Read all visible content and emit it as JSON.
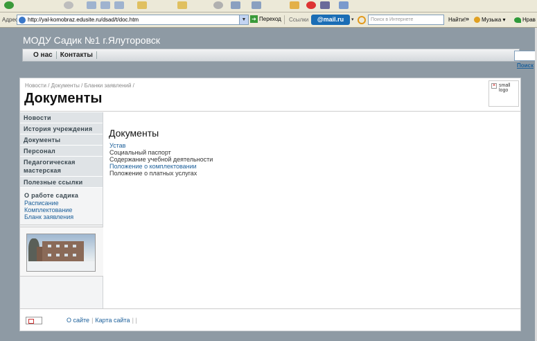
{
  "browser": {
    "address_label": "Адрес:",
    "url": "http://yal-komobraz.edusite.ru/dsad/t/doc.htm",
    "go_label": "Переход",
    "links_label": "Ссылки",
    "mailru_label": "@mail.ru",
    "search_placeholder": "Поиск в Интернете",
    "find_label": "Найти!",
    "more_label": "»",
    "music_label": "Музыка ▾",
    "pref_label": "Нрав"
  },
  "site": {
    "title": "МОДУ Садик №1 г.Ялуторовск",
    "topnav": [
      "О нас",
      "Контакты"
    ],
    "search_link": "Поиск"
  },
  "header": {
    "breadcrumb": [
      "Новости",
      "Документы",
      "Бланки заявлений"
    ],
    "page_title": "Документы",
    "logo_alt": "small logo"
  },
  "sidebar": {
    "items": [
      "Новости",
      "История учреждения",
      "Документы",
      "Персонал",
      "Педагогическая мастерская",
      "Полезные ссылки"
    ],
    "about_heading": "О работе садика",
    "about_links": [
      "Расписание",
      "Комплектование",
      "Бланк заявления"
    ]
  },
  "main": {
    "heading": "Документы",
    "documents": [
      "Устав",
      "Социальный паспорт",
      "Содержание учебной деятельности",
      "Положение о комплектовании",
      "Положение о платных услугах"
    ]
  },
  "footer": {
    "about_link": "О сайте",
    "sitemap_link": "Карта сайта"
  },
  "colors": {
    "page_bg": "#8e9aa4",
    "link": "#1b5f9a"
  }
}
